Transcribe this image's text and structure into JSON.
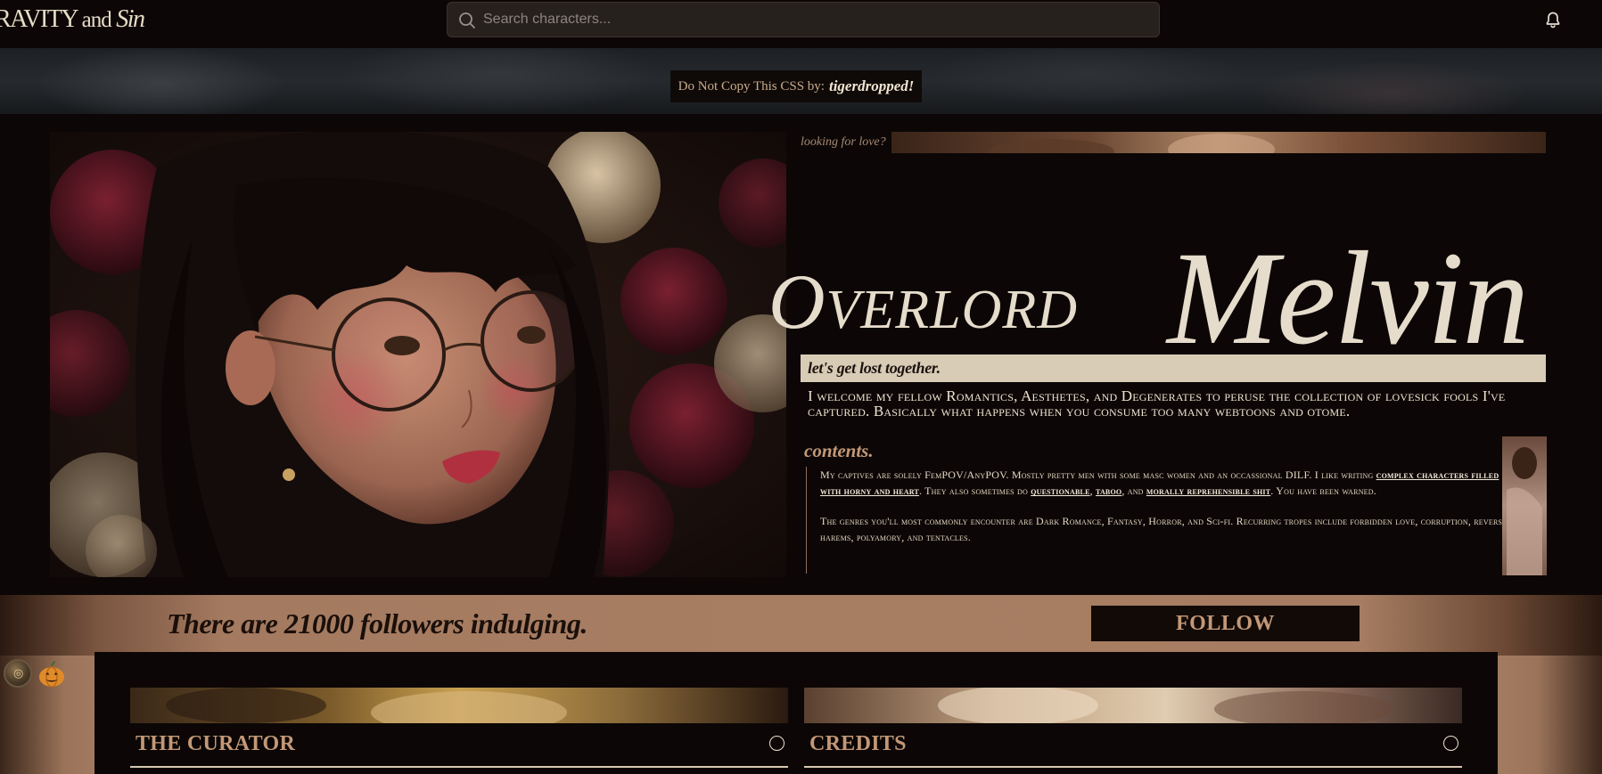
{
  "header": {
    "logo": {
      "part1": "RAVITY",
      "part2": "and",
      "part3": "Sin"
    },
    "search": {
      "placeholder": "Search characters..."
    },
    "icons": {
      "search": "search-icon",
      "notifications": "bell-icon"
    }
  },
  "banner": {
    "credit_prefix": "Do Not Copy This CSS by:",
    "credit_author": "tigerdropped!"
  },
  "profile": {
    "looking_for": "looking for love?",
    "name_first": "Overlord",
    "name_last": "Melvin",
    "tagline": "let's get lost together.",
    "welcome": "I welcome my fellow Romantics, Aesthetes, and Degenerates to peruse the collection of lovesick fools I've captured. Basically what happens when you consume too many webtoons and otome.",
    "contents_title": "contents.",
    "contents": {
      "p1_a": "My captives are solely FemPOV/AnyPOV. Mostly pretty men with some masc women and an occassional DILF. I like writing",
      "p1_link1": "complex characters filled with horny and heart",
      "p1_b": ". They also sometimes do",
      "p1_link2": "questionable",
      "p1_c": ",",
      "p1_link3": "taboo",
      "p1_d": ", and",
      "p1_link4": "morally reprehensible shit",
      "p1_e": ". You have been warned.",
      "p2": "The genres you'll most commonly encounter are Dark Romance, Fantasy, Horror, and Sci-fi. Recurring tropes include forbidden love, corruption, reverse harems, polyamory, and tentacles."
    }
  },
  "followers": {
    "text": "There are 21000 followers indulging.",
    "follow_label": "FOLLOW"
  },
  "floaty": {
    "pumpkin": "🎃"
  },
  "sections": [
    {
      "title": "THE CURATOR"
    },
    {
      "title": "CREDITS"
    }
  ],
  "colors": {
    "background": "#0c0706",
    "accent": "#c39877",
    "cream": "#d8ccb6",
    "band": "#a87e63"
  }
}
